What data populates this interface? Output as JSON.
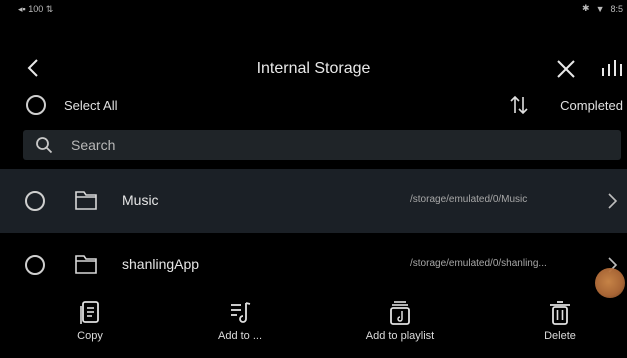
{
  "status_bar": {
    "left_text": "◂▪ 100 ⇅",
    "time": "8:5"
  },
  "header": {
    "title": "Internal Storage"
  },
  "select_all": {
    "label": "Select All",
    "completed_label": "Completed"
  },
  "search": {
    "placeholder": "Search"
  },
  "files": [
    {
      "name": "Music",
      "path": "/storage/emulated/0/Music",
      "selected": true
    },
    {
      "name": "shanlingApp",
      "path": "/storage/emulated/0/shanling...",
      "selected": false
    }
  ],
  "toolbar": {
    "copy": "Copy",
    "add_to": "Add to ...",
    "add_to_playlist": "Add to playlist",
    "delete": "Delete"
  },
  "icons": [
    "back-icon",
    "close-icon",
    "equalizer-icon",
    "sort-icon",
    "search-icon",
    "folder-icon",
    "chevron-right-icon",
    "copy-icon",
    "add-to-icon",
    "add-to-playlist-icon",
    "delete-icon"
  ]
}
